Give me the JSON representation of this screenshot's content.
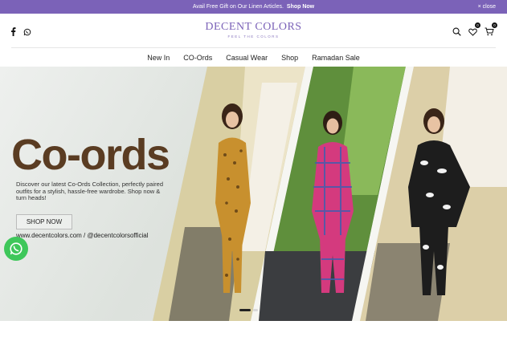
{
  "announcement": {
    "text": "Avail Free Gift on Our Linen Articles.",
    "link": "Shop Now",
    "close_label": "close"
  },
  "header": {
    "brand": "DECENT COLORS",
    "tagline": "FEEL THE COLORS",
    "wishlist_count": "0",
    "cart_count": "0",
    "social_icons": [
      "facebook-icon",
      "whatsapp-icon"
    ],
    "action_icons": [
      "search-icon",
      "wishlist-icon",
      "cart-icon"
    ]
  },
  "nav": {
    "items": [
      {
        "label": "New In"
      },
      {
        "label": "CO-Ords"
      },
      {
        "label": "Casual Wear"
      },
      {
        "label": "Shop"
      },
      {
        "label": "Ramadan Sale"
      }
    ]
  },
  "hero": {
    "title": "Co-ords",
    "description": "Discover our latest Co-Ords Collection, perfectly paired outfits for a stylish, hassle-free wardrobe. Shop now & turn heads!",
    "button": "SHOP NOW",
    "handles": "www.decentcolors.com / @decentcolorsofficial",
    "slide_count": 2,
    "active_slide": 1
  },
  "colors": {
    "brand_purple": "#7b62b8",
    "title_brown": "#5a3c22",
    "whatsapp_green": "#3ec75a"
  }
}
